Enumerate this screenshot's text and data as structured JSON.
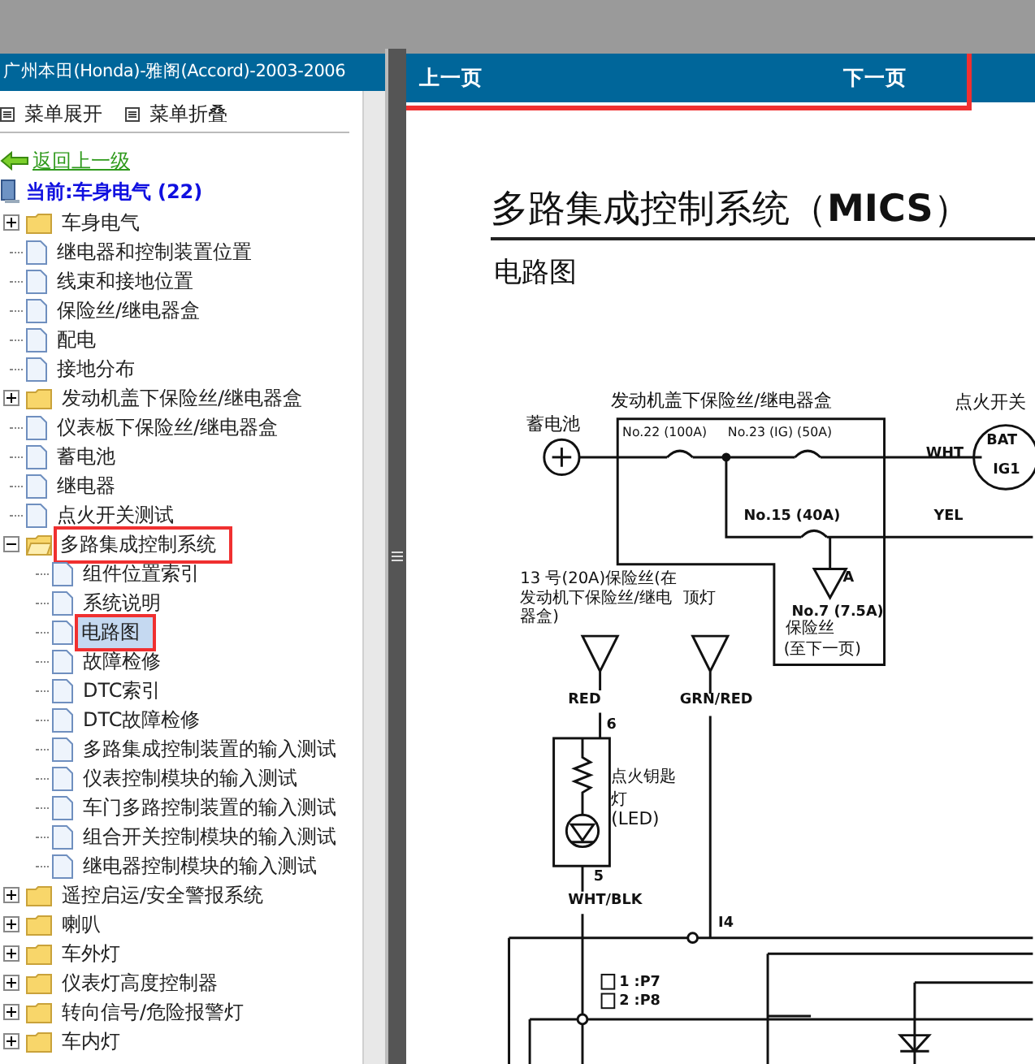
{
  "sidebar": {
    "title": "广州本田(Honda)-雅阁(Accord)-2003-2006",
    "menu": [
      "菜单展开",
      "菜单折叠"
    ],
    "back_link": "返回上一级",
    "current": "当前:车身电气 (22)",
    "tree": [
      {
        "label": "车身电气",
        "kind": "folder",
        "expanded": false,
        "selected": false,
        "annotated": false
      },
      {
        "label": "继电器和控制装置位置",
        "kind": "page",
        "selected": false,
        "annotated": false
      },
      {
        "label": "线束和接地位置",
        "kind": "page",
        "selected": false,
        "annotated": false
      },
      {
        "label": "保险丝/继电器盒",
        "kind": "page",
        "selected": false,
        "annotated": false
      },
      {
        "label": "配电",
        "kind": "page",
        "selected": false,
        "annotated": false
      },
      {
        "label": "接地分布",
        "kind": "page",
        "selected": false,
        "annotated": false
      },
      {
        "label": "发动机盖下保险丝/继电器盒",
        "kind": "folder",
        "expanded": false,
        "selected": false,
        "annotated": false
      },
      {
        "label": "仪表板下保险丝/继电器盒",
        "kind": "page",
        "selected": false,
        "annotated": false
      },
      {
        "label": "蓄电池",
        "kind": "page",
        "selected": false,
        "annotated": false
      },
      {
        "label": "继电器",
        "kind": "page",
        "selected": false,
        "annotated": false
      },
      {
        "label": "点火开关测试",
        "kind": "page",
        "selected": false,
        "annotated": false
      },
      {
        "label": "多路集成控制系统",
        "kind": "folder",
        "expanded": true,
        "selected": false,
        "annotated": true,
        "children": [
          {
            "label": "组件位置索引",
            "kind": "page",
            "selected": false,
            "annotated": false
          },
          {
            "label": "系统说明",
            "kind": "page",
            "selected": false,
            "annotated": false
          },
          {
            "label": "电路图",
            "kind": "page",
            "selected": true,
            "annotated": true
          },
          {
            "label": "故障检修",
            "kind": "page",
            "selected": false,
            "annotated": false
          },
          {
            "label": "DTC索引",
            "kind": "page",
            "selected": false,
            "annotated": false
          },
          {
            "label": "DTC故障检修",
            "kind": "page",
            "selected": false,
            "annotated": false
          },
          {
            "label": "多路集成控制装置的输入测试",
            "kind": "page",
            "selected": false,
            "annotated": false
          },
          {
            "label": "仪表控制模块的输入测试",
            "kind": "page",
            "selected": false,
            "annotated": false
          },
          {
            "label": "车门多路控制装置的输入测试",
            "kind": "page",
            "selected": false,
            "annotated": false
          },
          {
            "label": "组合开关控制模块的输入测试",
            "kind": "page",
            "selected": false,
            "annotated": false
          },
          {
            "label": "继电器控制模块的输入测试",
            "kind": "page",
            "selected": false,
            "annotated": false
          }
        ]
      },
      {
        "label": "遥控启运/安全警报系统",
        "kind": "folder",
        "expanded": false,
        "selected": false,
        "annotated": false
      },
      {
        "label": "喇叭",
        "kind": "folder",
        "expanded": false,
        "selected": false,
        "annotated": false
      },
      {
        "label": "车外灯",
        "kind": "folder",
        "expanded": false,
        "selected": false,
        "annotated": false
      },
      {
        "label": "仪表灯高度控制器",
        "kind": "folder",
        "expanded": false,
        "selected": false,
        "annotated": false
      },
      {
        "label": "转向信号/危险报警灯",
        "kind": "folder",
        "expanded": false,
        "selected": false,
        "annotated": false
      },
      {
        "label": "车内灯",
        "kind": "folder",
        "expanded": false,
        "selected": false,
        "annotated": false
      }
    ]
  },
  "nav": {
    "prev": "上一页",
    "next": "下一页",
    "annotated": true
  },
  "document": {
    "title": "多路集成控制系统（**MICS**）",
    "subtitle": "电路图",
    "diagram_labels": [
      "发动机盖下保险丝/继电器盒",
      "蓄电池",
      "点火开关",
      "No.22 (100A)",
      "No.23 (IG) (50A)",
      "WHT",
      "BAT",
      "IG1",
      "No.15 (40A)",
      "YEL",
      "A",
      "No.7 (7.5A)",
      "保险丝",
      "(至下一页)",
      "13 号(20A)保险丝(在",
      "发动机下保险丝/继电",
      "器盒)",
      "顶灯",
      "RED",
      "GRN/RED",
      "6",
      "点火钥匙",
      "灯",
      "(LED)",
      "5",
      "WHT/BLK",
      "I4",
      "1 :P7",
      "2 :P8"
    ]
  }
}
